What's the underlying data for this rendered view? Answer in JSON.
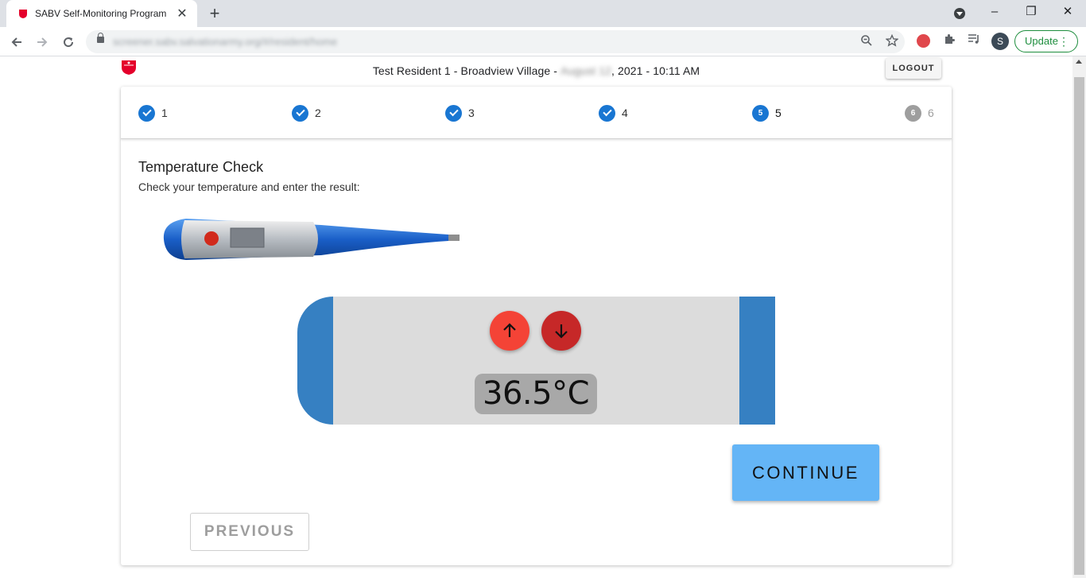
{
  "browser": {
    "tab_title": "SABV Self-Monitoring Program",
    "tab_close": "✕",
    "new_tab": "+",
    "url": "screener.sabv.salvationarmy.org/#/resident/home",
    "update_label": "Update",
    "avatar_letter": "S",
    "window_controls": {
      "minimize": "–",
      "restore": "❐",
      "close": "✕"
    }
  },
  "header": {
    "resident_line": "Test Resident 1 - Broadview Village - ",
    "blurred_date": "August 12",
    "date_suffix": ", 2021 - 10:11 AM",
    "logout_label": "LOGOUT"
  },
  "stepper": {
    "steps": [
      {
        "label": "1",
        "state": "complete"
      },
      {
        "label": "2",
        "state": "complete"
      },
      {
        "label": "3",
        "state": "complete"
      },
      {
        "label": "4",
        "state": "complete"
      },
      {
        "label": "5",
        "number": "5",
        "state": "active"
      },
      {
        "label": "6",
        "number": "6",
        "state": "inactive"
      }
    ]
  },
  "content": {
    "title": "Temperature Check",
    "subtitle": "Check your temperature and enter the result:",
    "temperature": "36.5°C",
    "continue_label": "CONTINUE",
    "previous_label": "PREVIOUS"
  },
  "colors": {
    "step_blue": "#1976d2",
    "display_blue": "#3680c2",
    "up_red": "#f44336",
    "down_red": "#c62828",
    "continue_blue": "#64b5f6"
  }
}
